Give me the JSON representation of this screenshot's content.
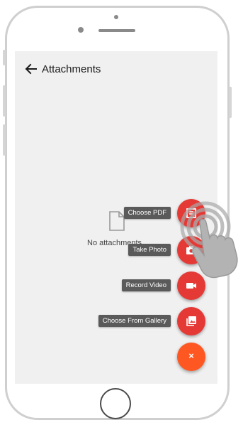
{
  "appbar": {
    "title": "Attachments",
    "back_icon": "arrow-left-icon"
  },
  "empty_state": {
    "icon": "document-icon",
    "text": "No attachments"
  },
  "fab_actions": [
    {
      "label": "Choose PDF",
      "icon": "pdf-icon"
    },
    {
      "label": "Take Photo",
      "icon": "camera-icon"
    },
    {
      "label": "Record Video",
      "icon": "videocam-icon"
    },
    {
      "label": "Choose From Gallery",
      "icon": "gallery-icon"
    }
  ],
  "fab_main": {
    "glyph": "×",
    "icon": "close-icon"
  },
  "colors": {
    "screen_bg": "#f0f0f0",
    "fab_action": "#e53935",
    "fab_main": "#ff5722",
    "label_bg": "#5a5a5a"
  }
}
